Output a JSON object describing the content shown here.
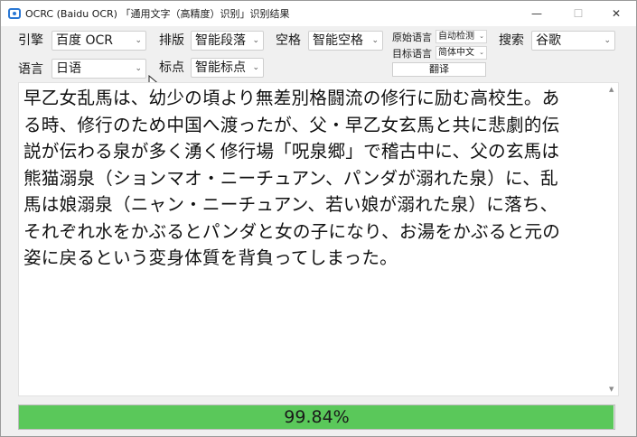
{
  "window": {
    "title": "OCRC (Baidu OCR) 「通用文字（高精度）识别」识别结果",
    "minimize": "—",
    "maximize": "☐",
    "close": "✕"
  },
  "toolbar": {
    "engine_label": "引擎",
    "engine_value": "百度 OCR",
    "layout_label": "排版",
    "layout_value": "智能段落",
    "space_label": "空格",
    "space_value": "智能空格",
    "source_lang_label": "原始语言",
    "source_lang_value": "自动检测",
    "target_lang_label": "目标语言",
    "target_lang_value": "简体中文",
    "translate_button": "翻译",
    "search_label": "搜索",
    "search_value": "谷歌",
    "language_label": "语言",
    "language_value": "日语",
    "punct_label": "标点",
    "punct_value": "智能标点"
  },
  "result": {
    "lines": [
      "早乙女乱馬は、幼少の頃より無差別格闘流の修行に励む高校生。あ",
      "る時、修行のため中国へ渡ったが、父・早乙女玄馬と共に悲劇的伝",
      "説が伝わる泉が多く湧く修行場「呪泉郷」で稽古中に、父の玄馬は",
      "熊猫溺泉（ションマオ・ニーチュアン、パンダが溺れた泉）に、乱",
      "馬は娘溺泉（ニャン・ニーチュアン、若い娘が溺れた泉）に落ち、",
      "それぞれ水をかぶるとパンダと女の子になり、お湯をかぶると元の",
      "姿に戻るという変身体質を背負ってしまった。"
    ]
  },
  "progress": {
    "value": 0.9984,
    "label": "99.84%"
  },
  "icons": {
    "chevron": "⌄",
    "scroll_up": "▲",
    "scroll_down": "▼"
  }
}
